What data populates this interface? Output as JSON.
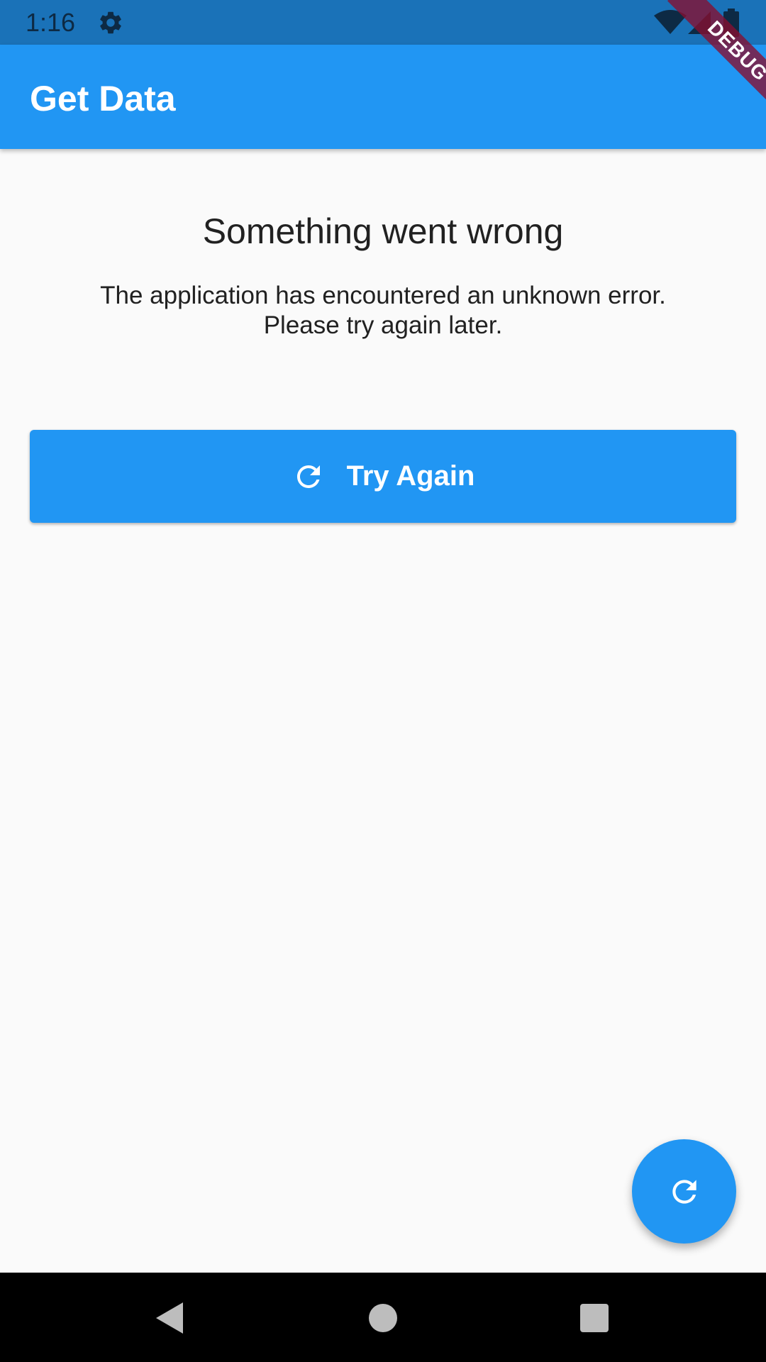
{
  "status_bar": {
    "time": "1:16",
    "icons": [
      "gear-icon",
      "wifi-icon",
      "signal-icon",
      "battery-icon"
    ]
  },
  "app_bar": {
    "title": "Get Data",
    "color": "#2196f3"
  },
  "debug_banner": {
    "label": "DEBUG"
  },
  "error": {
    "title": "Something went wrong",
    "message_line1": "The application has encountered an unknown error.",
    "message_line2": "Please try again later."
  },
  "retry_button": {
    "label": "Try Again",
    "icon": "refresh-icon"
  },
  "fab": {
    "icon": "refresh-icon"
  },
  "nav_bar": {
    "buttons": [
      "back-icon",
      "home-icon",
      "recents-icon"
    ]
  },
  "colors": {
    "primary": "#2196f3",
    "status_bar": "#1a72b8",
    "background": "#fafafa",
    "text": "#212121"
  }
}
